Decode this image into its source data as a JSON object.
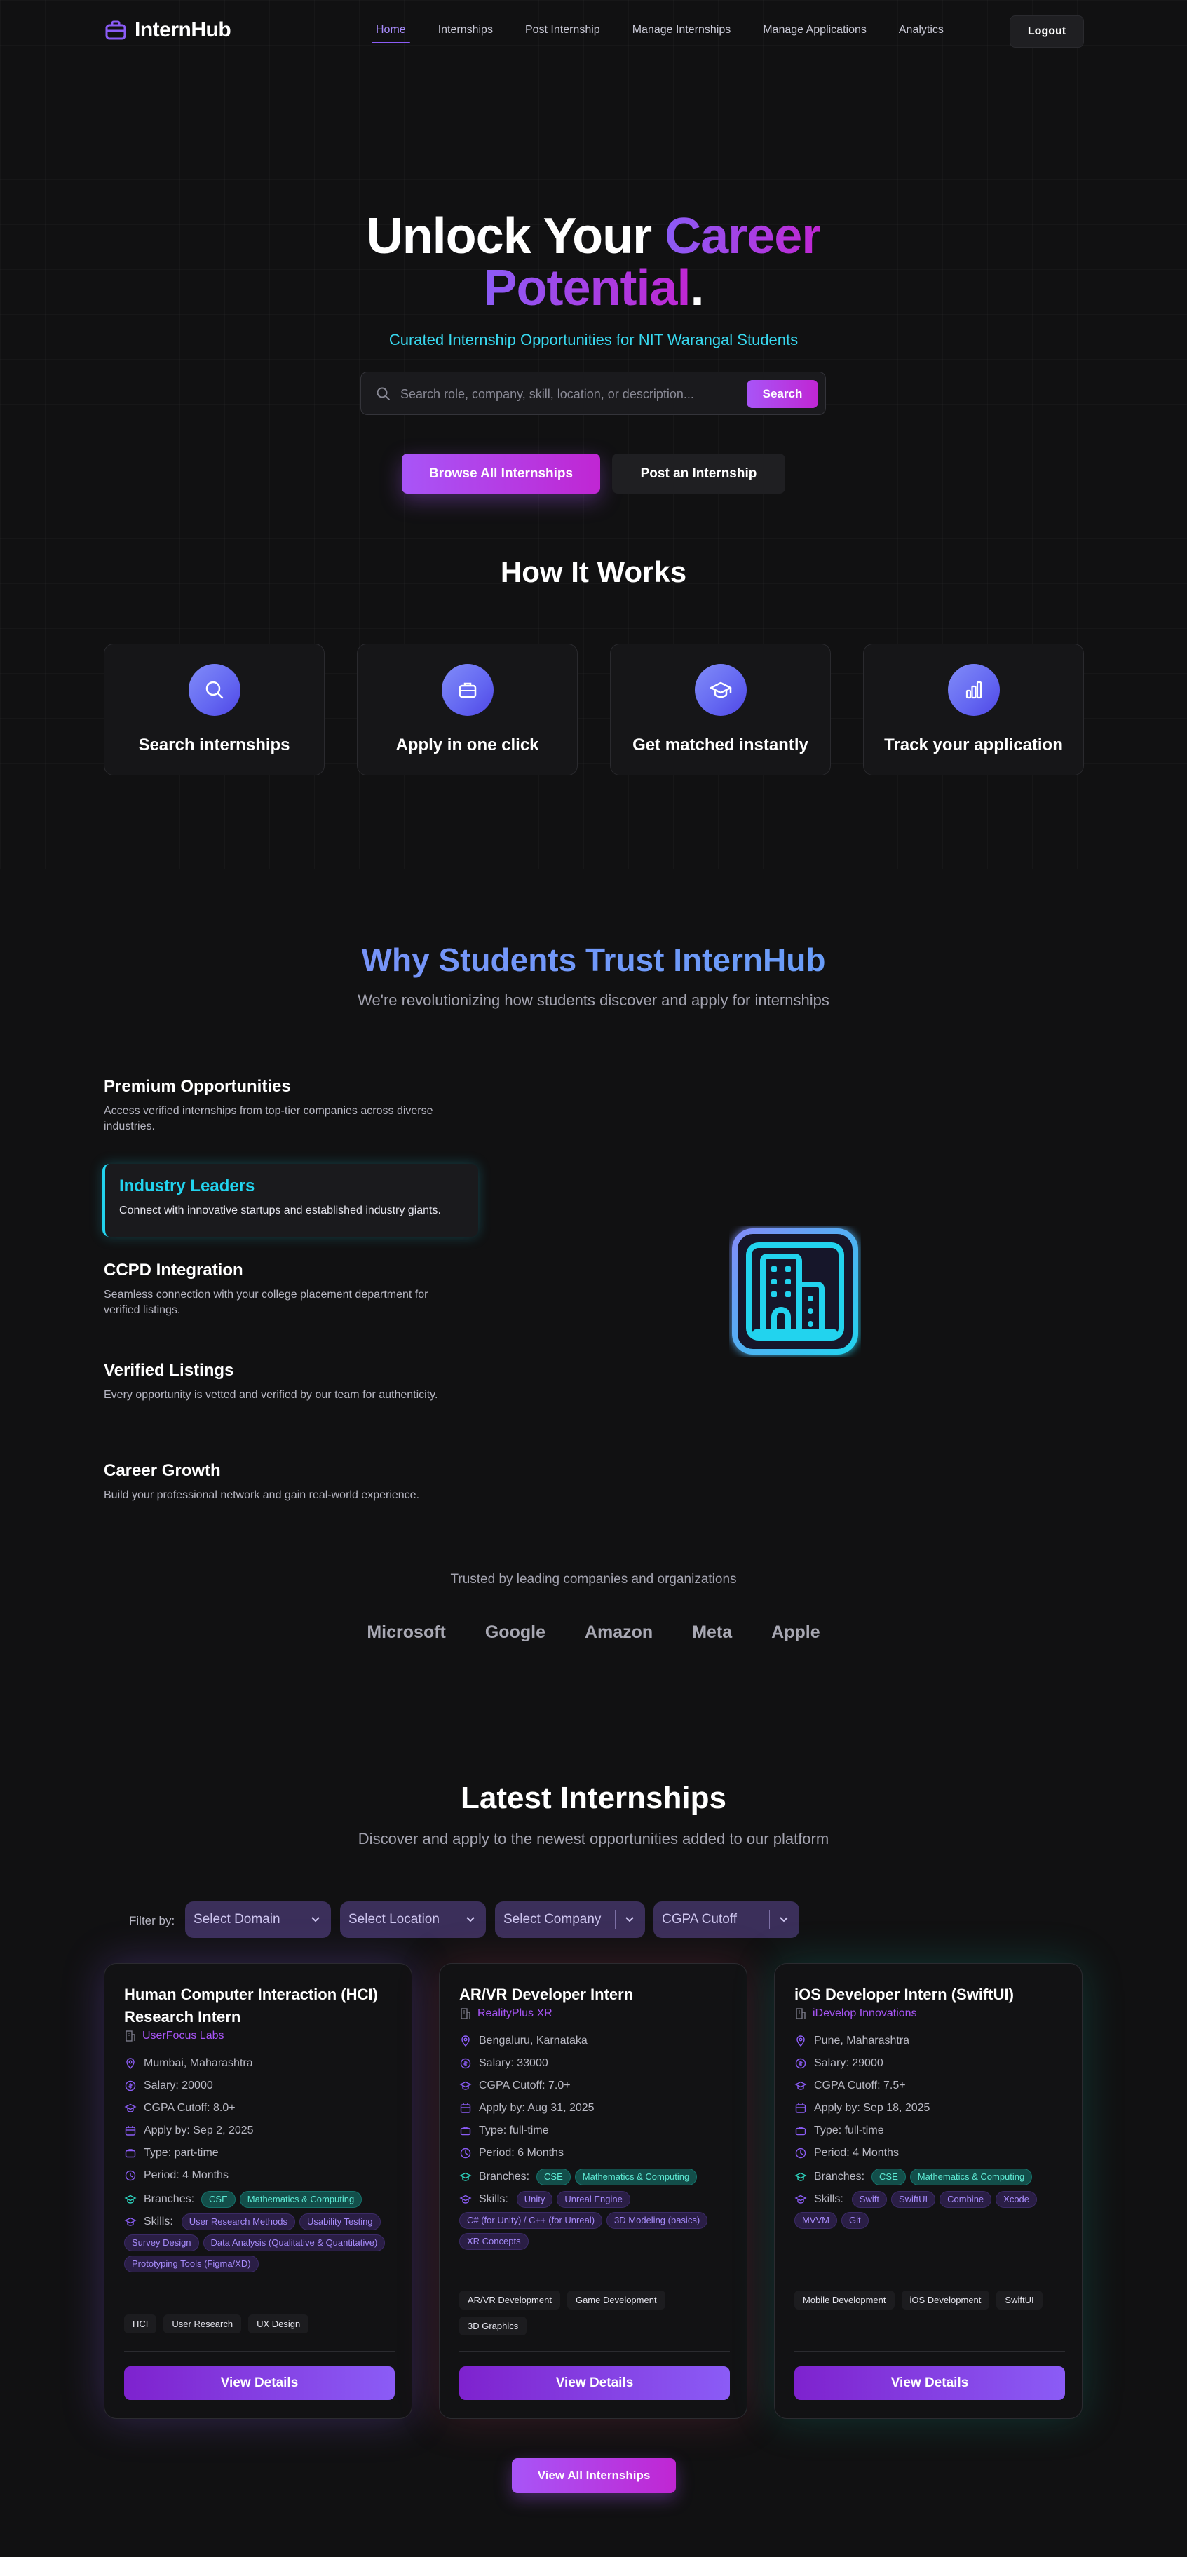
{
  "nav": {
    "brand": "InternHub",
    "links": [
      "Home",
      "Internships",
      "Post Internship",
      "Manage Internships",
      "Manage Applications",
      "Analytics"
    ],
    "logout": "Logout"
  },
  "hero": {
    "title_part1": "Unlock Your ",
    "title_part2": "Career",
    "title_part3": "Potential",
    "title_part4": ".",
    "subtitle": "Curated Internship Opportunities for NIT Warangal Students",
    "search_placeholder": "Search role, company, skill, location, or description...",
    "search_button": "Search",
    "browse_button": "Browse All Internships",
    "post_button": "Post an Internship"
  },
  "how": {
    "title": "How It Works",
    "steps": [
      {
        "label": "Search internships",
        "icon": "search-icon"
      },
      {
        "label": "Apply in one click",
        "icon": "briefcase-icon"
      },
      {
        "label": "Get matched instantly",
        "icon": "graduation-cap-icon"
      },
      {
        "label": "Track your application",
        "icon": "bar-chart-icon"
      }
    ]
  },
  "why": {
    "title": "Why Students Trust InternHub",
    "subtitle": "We're revolutionizing how students discover and apply for internships",
    "features": [
      {
        "title": "Premium Opportunities",
        "desc": "Access verified internships from top-tier companies across diverse industries."
      },
      {
        "title": "Industry Leaders",
        "desc": "Connect with innovative startups and established industry giants."
      },
      {
        "title": "CCPD Integration",
        "desc": "Seamless connection with your college placement department for verified listings."
      },
      {
        "title": "Verified Listings",
        "desc": "Every opportunity is vetted and verified by our team for authenticity."
      },
      {
        "title": "Career Growth",
        "desc": "Build your professional network and gain real-world experience."
      }
    ]
  },
  "trusted": {
    "text": "Trusted by leading companies and organizations",
    "companies": [
      "Microsoft",
      "Google",
      "Amazon",
      "Meta",
      "Apple"
    ]
  },
  "latest": {
    "title": "Latest Internships",
    "subtitle": "Discover and apply to the newest opportunities added to our platform",
    "filter_label": "Filter by:",
    "filters": [
      "Select Domain",
      "Select Location",
      "Select Company",
      "CGPA Cutoff"
    ],
    "view_details": "View Details",
    "view_all": "View All Internships",
    "branches_label": "Branches:",
    "skills_label": "Skills:",
    "jobs": [
      {
        "title": "Human Computer Interaction (HCI) Research Intern",
        "company": "UserFocus Labs",
        "location": "Mumbai, Maharashtra",
        "salary": "Salary: 20000",
        "cgpa": "CGPA Cutoff: 8.0+",
        "apply_by": "Apply by: Sep 2, 2025",
        "type": "Type: part-time",
        "period": "Period: 4 Months",
        "branches": [
          "CSE",
          "Mathematics & Computing"
        ],
        "skills": [
          "User Research Methods",
          "Usability Testing",
          "Survey Design",
          "Data Analysis (Qualitative & Quantitative)",
          "Prototyping Tools (Figma/XD)"
        ],
        "tags": [
          "HCI",
          "User Research",
          "UX Design"
        ]
      },
      {
        "title": "AR/VR Developer Intern",
        "company": "RealityPlus XR",
        "location": "Bengaluru, Karnataka",
        "salary": "Salary: 33000",
        "cgpa": "CGPA Cutoff: 7.0+",
        "apply_by": "Apply by: Aug 31, 2025",
        "type": "Type: full-time",
        "period": "Period: 6 Months",
        "branches": [
          "CSE",
          "Mathematics & Computing"
        ],
        "skills": [
          "Unity",
          "Unreal Engine",
          "C# (for Unity) / C++ (for Unreal)",
          "3D Modeling (basics)",
          "XR Concepts"
        ],
        "tags": [
          "AR/VR Development",
          "Game Development",
          "3D Graphics"
        ]
      },
      {
        "title": "iOS Developer Intern (SwiftUI)",
        "company": "iDevelop Innovations",
        "location": "Pune, Maharashtra",
        "salary": "Salary: 29000",
        "cgpa": "CGPA Cutoff: 7.5+",
        "apply_by": "Apply by: Sep 18, 2025",
        "type": "Type: full-time",
        "period": "Period: 4 Months",
        "branches": [
          "CSE",
          "Mathematics & Computing"
        ],
        "skills": [
          "Swift",
          "SwiftUI",
          "Combine",
          "Xcode",
          "MVVM",
          "Git"
        ],
        "tags": [
          "Mobile Development",
          "iOS Development",
          "SwiftUI"
        ]
      }
    ]
  },
  "colors": {
    "background": "#111112",
    "accent": "#a855f7",
    "cyan": "#22d3ee",
    "indigo": "#818cf8"
  }
}
